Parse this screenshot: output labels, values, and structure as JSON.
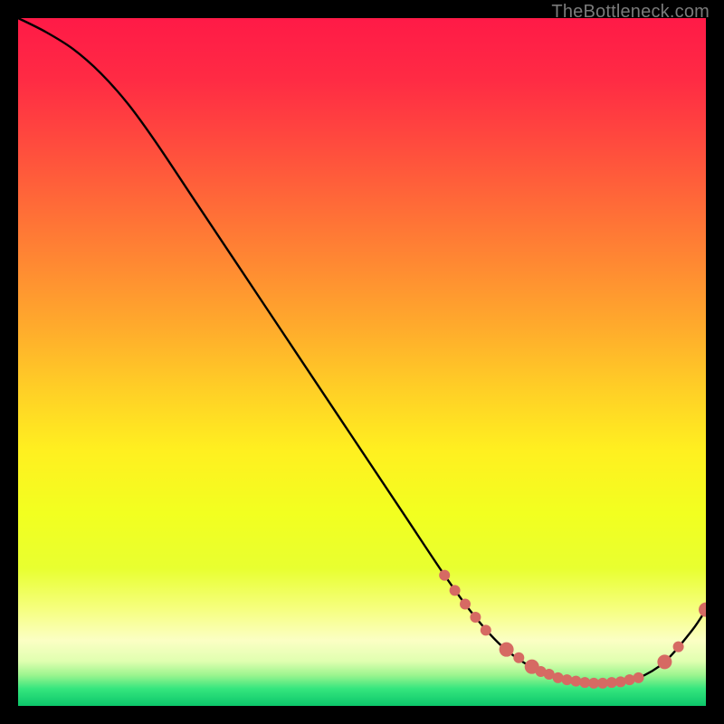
{
  "watermark": "TheBottleneck.com",
  "chart_data": {
    "type": "line",
    "title": "",
    "xlabel": "",
    "ylabel": "",
    "xlim": [
      0,
      100
    ],
    "ylim": [
      0,
      100
    ],
    "grid": false,
    "legend": false,
    "series": [
      {
        "name": "curve",
        "color": "#000000",
        "x": [
          0,
          4,
          8,
          12,
          16,
          20,
          26,
          32,
          38,
          44,
          50,
          56,
          62,
          66,
          70,
          74,
          78,
          82,
          86,
          90,
          94,
          98,
          100
        ],
        "y": [
          100,
          98,
          95.5,
          92,
          87.5,
          82,
          73,
          64,
          55,
          46,
          37,
          28,
          19,
          13.5,
          9,
          6,
          4.2,
          3.4,
          3.3,
          4.0,
          6.4,
          11,
          14
        ]
      }
    ],
    "markers": {
      "color": "#d66a63",
      "radius_small": 6,
      "radius_large": 8,
      "points": [
        {
          "x": 62.0,
          "y": 19.0,
          "r": 6
        },
        {
          "x": 63.5,
          "y": 16.8,
          "r": 6
        },
        {
          "x": 65.0,
          "y": 14.8,
          "r": 6
        },
        {
          "x": 66.5,
          "y": 12.9,
          "r": 6
        },
        {
          "x": 68.0,
          "y": 11.0,
          "r": 6
        },
        {
          "x": 71.0,
          "y": 8.2,
          "r": 8
        },
        {
          "x": 72.8,
          "y": 7.0,
          "r": 6
        },
        {
          "x": 74.7,
          "y": 5.7,
          "r": 8
        },
        {
          "x": 76.0,
          "y": 5.0,
          "r": 6
        },
        {
          "x": 77.2,
          "y": 4.6,
          "r": 6
        },
        {
          "x": 78.5,
          "y": 4.1,
          "r": 6
        },
        {
          "x": 79.8,
          "y": 3.8,
          "r": 6
        },
        {
          "x": 81.1,
          "y": 3.6,
          "r": 6
        },
        {
          "x": 82.4,
          "y": 3.4,
          "r": 6
        },
        {
          "x": 83.7,
          "y": 3.3,
          "r": 6
        },
        {
          "x": 85.0,
          "y": 3.3,
          "r": 6
        },
        {
          "x": 86.3,
          "y": 3.4,
          "r": 6
        },
        {
          "x": 87.6,
          "y": 3.5,
          "r": 6
        },
        {
          "x": 88.9,
          "y": 3.8,
          "r": 6
        },
        {
          "x": 90.2,
          "y": 4.1,
          "r": 6
        },
        {
          "x": 94.0,
          "y": 6.4,
          "r": 8
        },
        {
          "x": 96.0,
          "y": 8.6,
          "r": 6
        },
        {
          "x": 100.0,
          "y": 14.0,
          "r": 8
        }
      ]
    },
    "background_gradient": {
      "stops": [
        {
          "offset": 0.0,
          "color": "#ff1a47"
        },
        {
          "offset": 0.09,
          "color": "#ff2b44"
        },
        {
          "offset": 0.18,
          "color": "#ff4a3e"
        },
        {
          "offset": 0.27,
          "color": "#ff6a38"
        },
        {
          "offset": 0.36,
          "color": "#ff8a32"
        },
        {
          "offset": 0.45,
          "color": "#ffab2c"
        },
        {
          "offset": 0.54,
          "color": "#ffcf26"
        },
        {
          "offset": 0.63,
          "color": "#fff020"
        },
        {
          "offset": 0.72,
          "color": "#f2ff20"
        },
        {
          "offset": 0.8,
          "color": "#e8ff30"
        },
        {
          "offset": 0.86,
          "color": "#f6ff80"
        },
        {
          "offset": 0.905,
          "color": "#fbffc4"
        },
        {
          "offset": 0.935,
          "color": "#e0ffb0"
        },
        {
          "offset": 0.955,
          "color": "#9df58f"
        },
        {
          "offset": 0.975,
          "color": "#35e67e"
        },
        {
          "offset": 1.0,
          "color": "#0cc66a"
        }
      ]
    }
  }
}
